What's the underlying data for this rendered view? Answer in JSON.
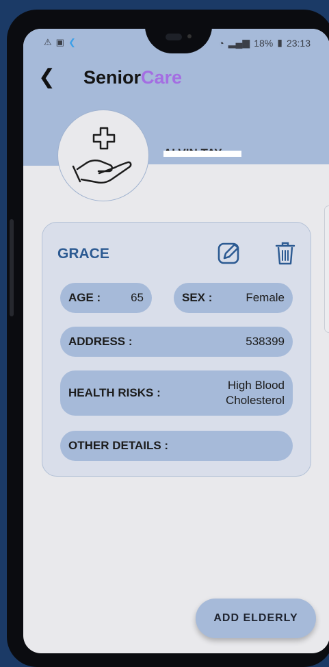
{
  "status_bar": {
    "left_icons": [
      "warning-icon",
      "image-icon",
      "flutter-icon"
    ],
    "battery": "18%",
    "time": "23:13"
  },
  "header": {
    "title_part1": "Senior",
    "title_part2": "Care",
    "user_name": "ALVIN TAY"
  },
  "card": {
    "name": "GRACE",
    "age_label": "AGE :",
    "age": "65",
    "sex_label": "SEX :",
    "sex": "Female",
    "address_label": "ADDRESS :",
    "address": "538399",
    "health_label": "HEALTH RISKS :",
    "health_line1": "High Blood",
    "health_line2": "Cholesterol",
    "other_label": "OTHER DETAILS :",
    "other": ""
  },
  "fab": {
    "label": "ADD ELDERLY"
  },
  "colors": {
    "accent": "#a46ee2",
    "header": "#a6bad9",
    "name": "#2c5a92"
  }
}
